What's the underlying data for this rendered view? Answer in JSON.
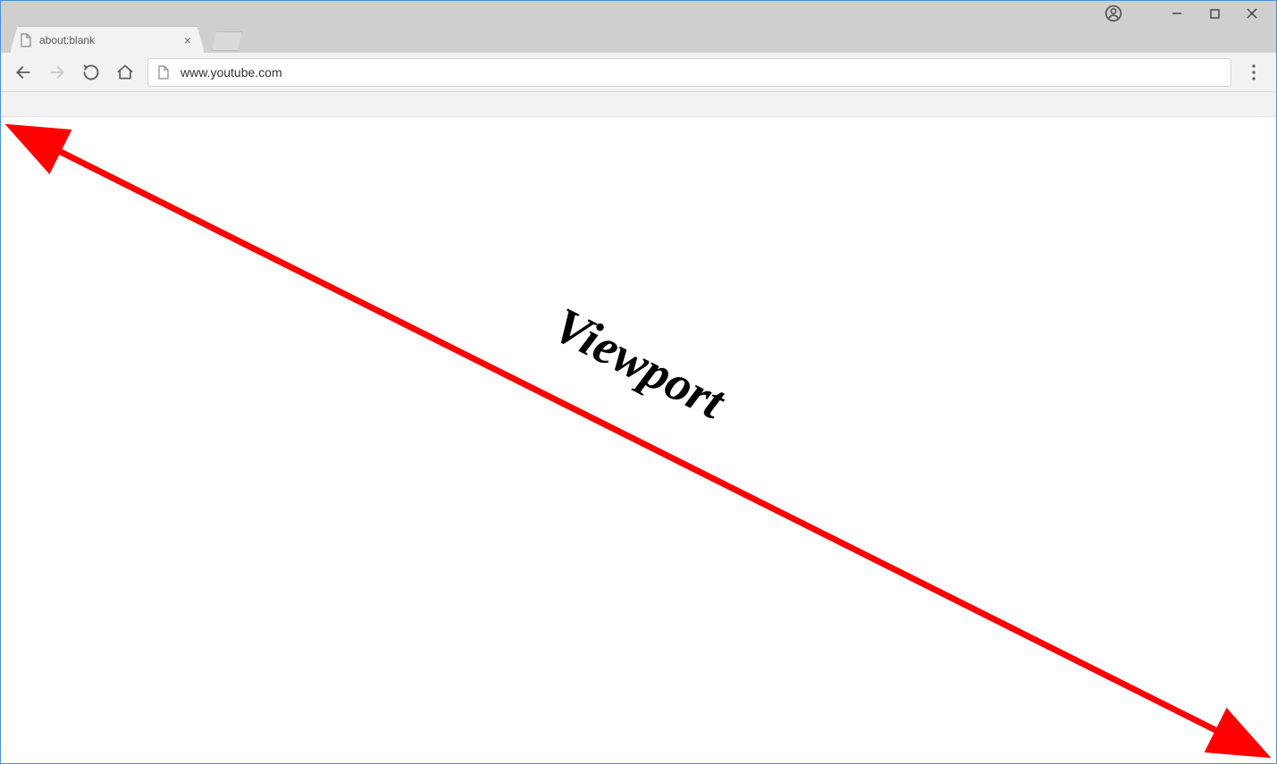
{
  "window_controls": {
    "minimize_glyph": "—",
    "maximize_glyph": "□",
    "close_glyph": "✕"
  },
  "tab": {
    "title": "about:blank",
    "close_glyph": "×"
  },
  "address_bar": {
    "url": "www.youtube.com"
  },
  "annotation": {
    "label": "Viewport",
    "arrow_color": "#ff0000"
  }
}
